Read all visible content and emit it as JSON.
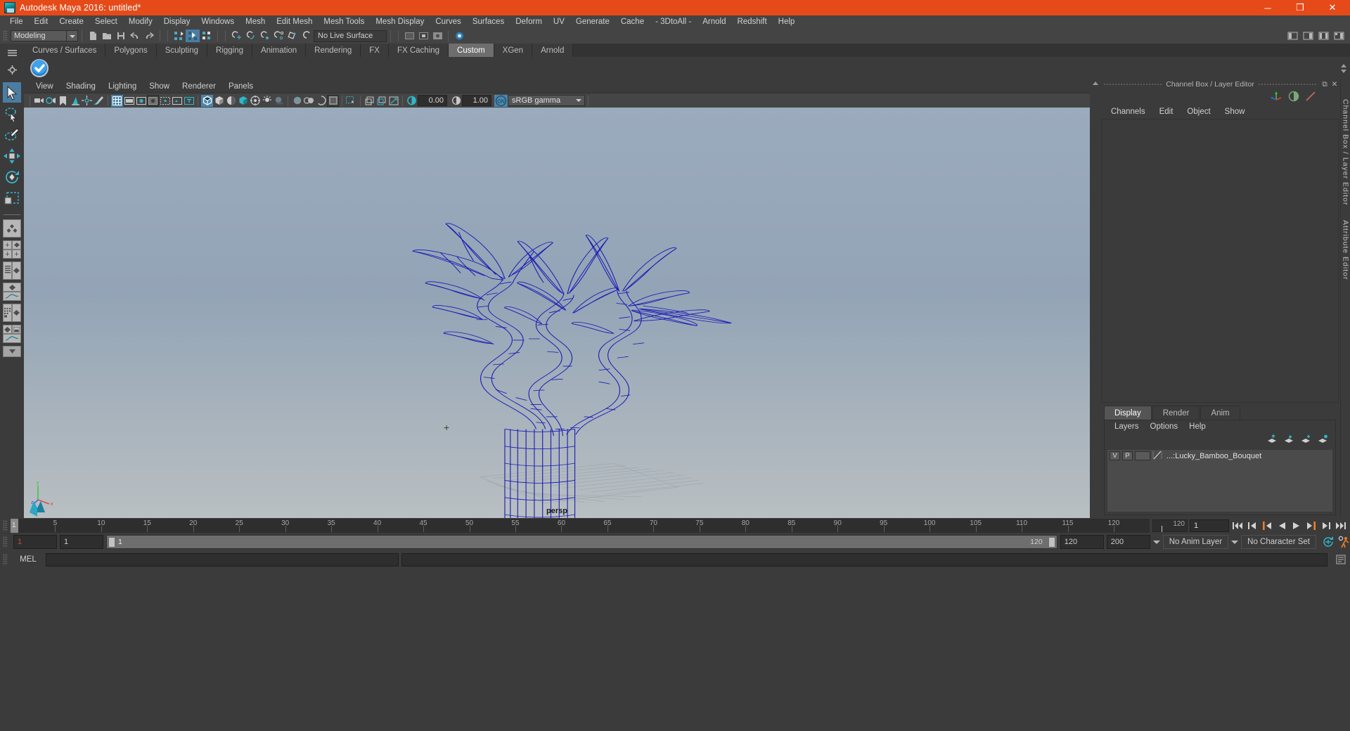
{
  "window": {
    "title": "Autodesk Maya 2016: untitled*",
    "app_icon": "maya-logo-icon",
    "buttons": [
      {
        "name": "minimize-button",
        "glyph": "─"
      },
      {
        "name": "maximize-button",
        "glyph": "❐"
      },
      {
        "name": "close-button",
        "glyph": "✕"
      }
    ],
    "accent_color": "#e64a19"
  },
  "menubar": {
    "items": [
      "File",
      "Edit",
      "Create",
      "Select",
      "Modify",
      "Display",
      "Windows",
      "Mesh",
      "Edit Mesh",
      "Mesh Tools",
      "Mesh Display",
      "Curves",
      "Surfaces",
      "Deform",
      "UV",
      "Generate",
      "Cache",
      "- 3DtoAll -",
      "Arnold",
      "Redshift",
      "Help"
    ]
  },
  "statusline": {
    "menu_set": "Modeling",
    "live_surface": "No Live Surface",
    "icons": [
      "new-scene-icon",
      "open-scene-icon",
      "save-scene-icon",
      "undo-icon",
      "redo-icon",
      "select-hierarchy-icon",
      "select-object-icon",
      "select-component-icon",
      "snap-grid-icon",
      "snap-curve-icon",
      "snap-point-icon",
      "snap-projected-center-icon",
      "snap-view-plane-icon",
      "make-live-icon",
      "show-hide-editors-icon",
      "attribute-editor-icon",
      "tool-settings-icon",
      "channel-box-icon"
    ]
  },
  "shelf": {
    "tabs": [
      "Curves / Surfaces",
      "Polygons",
      "Sculpting",
      "Rigging",
      "Animation",
      "Rendering",
      "FX",
      "FX Caching",
      "Custom",
      "XGen",
      "Arnold"
    ],
    "active_tab": "Custom",
    "buttons": [
      {
        "name": "custom-shelf-check-button",
        "icon": "blue-check-sphere-icon"
      }
    ]
  },
  "toolbox": {
    "tools": [
      {
        "name": "select-tool",
        "icon": "arrow-cursor-icon",
        "selected": true
      },
      {
        "name": "lasso-select-tool",
        "icon": "lasso-cursor-icon",
        "selected": false
      },
      {
        "name": "paint-select-tool",
        "icon": "paint-brush-select-icon",
        "selected": false
      },
      {
        "name": "move-tool",
        "icon": "move-arrows-icon",
        "selected": false
      },
      {
        "name": "rotate-tool",
        "icon": "rotate-circle-icon",
        "selected": false
      },
      {
        "name": "scale-tool",
        "icon": "scale-box-icon",
        "selected": false
      }
    ],
    "layouts": [
      {
        "name": "single-perspective-layout",
        "icon": "single-pane-icon"
      },
      {
        "name": "four-view-layout",
        "icon": "four-pane-icon"
      },
      {
        "name": "persp-outliner-layout",
        "icon": "outliner-pane-icon"
      },
      {
        "name": "persp-graph-layout",
        "icon": "graph-editor-pane-icon"
      },
      {
        "name": "hypershade-layout",
        "icon": "hypershade-pane-icon"
      },
      {
        "name": "persp-trax-layout",
        "icon": "trax-pane-icon"
      },
      {
        "name": "more-layouts-button",
        "icon": "chevron-down-icon"
      }
    ]
  },
  "viewport": {
    "menu": [
      "View",
      "Shading",
      "Lighting",
      "Show",
      "Renderer",
      "Panels"
    ],
    "camera_label": "persp",
    "exposure": "0.00",
    "gamma": "1.00",
    "color_management": "sRGB gamma",
    "view_transform_toggle": "ON",
    "toolbar_icons": [
      "camera-select-icon",
      "camera-attributes-icon",
      "bookmark-icon",
      "image-plane-icon",
      "two-d-pan-zoom-icon",
      "grease-pencil-icon",
      "grid-toggle-icon",
      "film-gate-icon",
      "resolution-gate-icon",
      "gate-mask-icon",
      "film-origin-icon",
      "safe-action-icon",
      "safe-title-icon",
      "wireframe-shading-icon",
      "smooth-shade-all-icon",
      "smooth-shade-selected-icon",
      "flat-shade-icon",
      "wireframe-on-shaded-icon",
      "use-default-lighting-icon",
      "shadows-icon",
      "ambient-occlusion-icon",
      "motion-blur-icon",
      "multisample-icon",
      "isolate-select-icon",
      "xray-icon",
      "xray-joints-icon",
      "xray-active-components-icon",
      "exposure-icon",
      "gamma-icon",
      "view-transform-icon"
    ],
    "axis_labels": [
      "y",
      "z",
      "x"
    ],
    "scene_object": "lucky bamboo bouquet wireframe"
  },
  "channel_box": {
    "panel_title": "Channel Box / Layer Editor",
    "window_buttons": [
      {
        "name": "undock-panel-button",
        "glyph": "⧉"
      },
      {
        "name": "close-panel-button",
        "glyph": "✕"
      }
    ],
    "header_icons": [
      "move-axis-icon",
      "contrast-circle-icon",
      "slash-line-icon"
    ],
    "menu": [
      "Channels",
      "Edit",
      "Object",
      "Show"
    ],
    "content": ""
  },
  "layer_editor": {
    "tabs": [
      "Display",
      "Render",
      "Anim"
    ],
    "active_tab": "Display",
    "menu": [
      "Layers",
      "Options",
      "Help"
    ],
    "buttons": [
      "move-layer-up-icon",
      "move-layer-down-icon",
      "create-new-layer-icon",
      "create-layer-from-selected-icon"
    ],
    "layers": [
      {
        "visibility": "V",
        "playback": "P",
        "color": "",
        "name": "...:Lucky_Bamboo_Bouquet"
      }
    ]
  },
  "right_tabs": [
    "Channel Box / Layer Editor",
    "Attribute Editor"
  ],
  "time_slider": {
    "start": 1,
    "end": 120,
    "current_frame": "1",
    "tick_labels": [
      5,
      10,
      15,
      20,
      25,
      30,
      35,
      40,
      45,
      50,
      55,
      60,
      65,
      70,
      75,
      80,
      85,
      90,
      95,
      100,
      105,
      110,
      115,
      120
    ],
    "current_frame_display": "1",
    "max_display": "120",
    "playback_buttons": [
      {
        "name": "go-to-start-button",
        "icon": "skip-start-icon"
      },
      {
        "name": "step-back-key-button",
        "icon": "prev-key-icon"
      },
      {
        "name": "step-back-frame-button",
        "icon": "prev-frame-icon"
      },
      {
        "name": "play-backwards-button",
        "icon": "play-backward-icon"
      },
      {
        "name": "play-forwards-button",
        "icon": "play-forward-icon"
      },
      {
        "name": "step-forward-frame-button",
        "icon": "next-frame-icon"
      },
      {
        "name": "step-forward-key-button",
        "icon": "next-key-icon"
      },
      {
        "name": "go-to-end-button",
        "icon": "skip-end-icon"
      }
    ]
  },
  "range_slider": {
    "anim_start": "1",
    "range_start": "1",
    "bar_start": "1",
    "bar_end": "120",
    "range_end": "120",
    "anim_end": "200",
    "anim_layer": "No Anim Layer",
    "character_set": "No Character Set",
    "auto_key_icon": "auto-keyframe-icon",
    "anim_prefs_icon": "animation-preferences-icon"
  },
  "command_line": {
    "language_label": "MEL",
    "input_value": "",
    "output_value": "",
    "script_editor_icon": "script-editor-icon"
  }
}
